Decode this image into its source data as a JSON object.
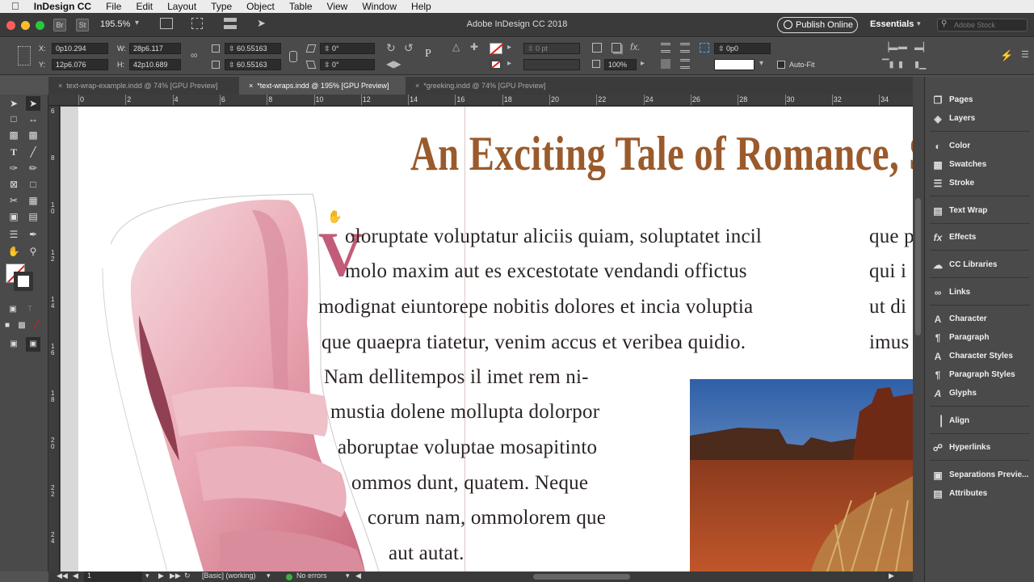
{
  "menubar": {
    "app": "InDesign CC",
    "items": [
      "File",
      "Edit",
      "Layout",
      "Type",
      "Object",
      "Table",
      "View",
      "Window",
      "Help"
    ]
  },
  "titlebar": {
    "title": "Adobe InDesign CC 2018",
    "zoom": "195.5%",
    "br_label": "Br",
    "st_label": "St",
    "publish_label": "Publish Online",
    "workspace": "Essentials",
    "search_placeholder": "Adobe Stock"
  },
  "controlbar": {
    "x_label": "X:",
    "x_value": "0p10.294",
    "y_label": "Y:",
    "y_value": "12p6.076",
    "w_label": "W:",
    "w_value": "28p6.117",
    "h_label": "H:",
    "h_value": "42p10.689",
    "scale_x": "60.55163",
    "scale_y": "60.55163",
    "angle1": "0°",
    "angle2": "0°",
    "stroke_weight": "0 pt",
    "opacity": "100%",
    "offset": "0p0",
    "autofit_label": "Auto-Fit"
  },
  "tabs": [
    {
      "label": "text-wrap-example.indd @ 74% [GPU Preview]",
      "active": false
    },
    {
      "label": "*text-wraps.indd @ 195% [GPU Preview]",
      "active": true
    },
    {
      "label": "*greeking.indd @ 74% [GPU Preview]",
      "active": false
    }
  ],
  "ruler": {
    "top_ticks": [
      "0",
      "2",
      "4",
      "6",
      "8",
      "10",
      "12",
      "14",
      "16",
      "18",
      "20",
      "22",
      "24",
      "26",
      "28",
      "30",
      "32",
      "34"
    ],
    "left_ticks": [
      "6",
      "8",
      "1 0",
      "1 2",
      "1 4",
      "1 6",
      "1 8",
      "2 0",
      "2 2",
      "2 4"
    ]
  },
  "document": {
    "headline": "An Exciting Tale of Romance, Sp",
    "dropcap": "V",
    "lines": [
      "oloruptate voluptatur aliciis quiam, soluptatet incil",
      "molo maxim aut es excestotate vendandi offictus",
      "modignat eiuntorepe nobitis dolores et incia voluptia",
      "que quaepra tiatetur, venim accus et veribea quidio.",
      "Nam dellitempos il imet rem ni-",
      "mustia dolene mollupta dolorpor",
      "aboruptae voluptae mosapitinto",
      "ommos dunt, quatem. Neque",
      "corum nam, ommolorem que",
      "aut autat."
    ],
    "col2_lines": [
      "que p",
      "qui i",
      "ut di",
      "imus"
    ]
  },
  "statusbar": {
    "page": "1",
    "style": "[Basic] (working)",
    "errors": "No errors"
  },
  "panel": {
    "items": [
      {
        "label": "Pages",
        "icon": "pages-icon"
      },
      {
        "label": "Layers",
        "icon": "layers-icon"
      },
      {
        "label": "Color",
        "icon": "color-icon"
      },
      {
        "label": "Swatches",
        "icon": "swatches-icon"
      },
      {
        "label": "Stroke",
        "icon": "stroke-icon"
      },
      {
        "label": "Text Wrap",
        "icon": "text-wrap-icon"
      },
      {
        "label": "Effects",
        "icon": "effects-icon"
      },
      {
        "label": "CC Libraries",
        "icon": "cc-libraries-icon"
      },
      {
        "label": "Links",
        "icon": "links-icon"
      },
      {
        "label": "Character",
        "icon": "character-icon"
      },
      {
        "label": "Paragraph",
        "icon": "paragraph-icon"
      },
      {
        "label": "Character Styles",
        "icon": "character-styles-icon"
      },
      {
        "label": "Paragraph Styles",
        "icon": "paragraph-styles-icon"
      },
      {
        "label": "Glyphs",
        "icon": "glyphs-icon"
      },
      {
        "label": "Align",
        "icon": "align-icon"
      },
      {
        "label": "Hyperlinks",
        "icon": "hyperlinks-icon"
      },
      {
        "label": "Separations Previe...",
        "icon": "separations-icon"
      },
      {
        "label": "Attributes",
        "icon": "attributes-icon"
      }
    ]
  },
  "colors": {
    "headline": "#9a5a2c",
    "dropcap": "#c25c78",
    "status_ok": "#3cb043"
  }
}
